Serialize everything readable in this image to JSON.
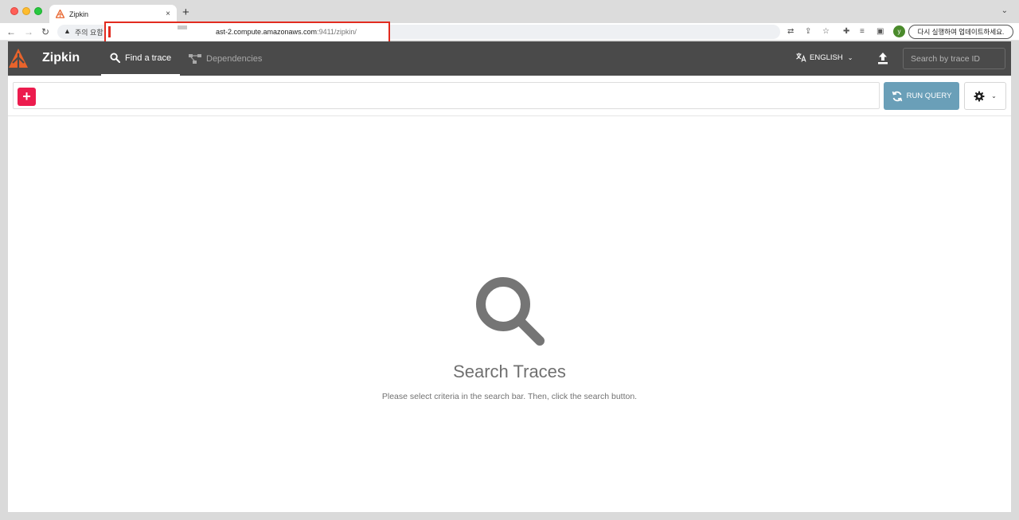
{
  "browser": {
    "tab_title": "Zipkin",
    "tab_close": "×",
    "new_tab": "+",
    "tab_menu": "⌄",
    "security_warning": "주의 요함",
    "url_host": "ast-2.compute.amazonaws.com",
    "url_path": ":9411/zipkin/",
    "profile_initial": "y",
    "update_button": "다시 실행하여 업데이트하세요."
  },
  "appbar": {
    "brand": "Zipkin",
    "nav": [
      {
        "label": "Find a trace",
        "active": true
      },
      {
        "label": "Dependencies",
        "active": false
      }
    ],
    "language": "ENGLISH",
    "trace_search_placeholder": "Search by trace ID"
  },
  "querybar": {
    "add_label": "+",
    "run_query_label": "RUN QUERY"
  },
  "empty_state": {
    "title": "Search Traces",
    "subtitle": "Please select criteria in the search bar. Then, click the search button."
  },
  "colors": {
    "appbar_bg": "#4a4a4a",
    "accent_red": "#ec1c4e",
    "run_query_bg": "#6a9fb8",
    "url_highlight": "#e22b1f",
    "logo_orange": "#e8632b"
  }
}
